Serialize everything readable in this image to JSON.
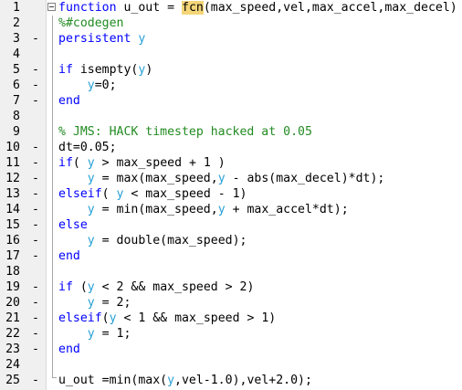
{
  "editor": {
    "line_numbers": [
      "1",
      "2",
      "3",
      "4",
      "5",
      "6",
      "7",
      "8",
      "9",
      "10",
      "11",
      "12",
      "13",
      "14",
      "15",
      "16",
      "17",
      "18",
      "19",
      "20",
      "21",
      "22",
      "23",
      "24",
      "25"
    ],
    "lines": [
      {
        "dash": false,
        "tokens": [
          {
            "t": "function",
            "c": "kw"
          },
          {
            "t": " u_out = "
          },
          {
            "t": "fcn",
            "c": "hl"
          },
          {
            "t": "(max_speed,vel,max_accel,max_decel)"
          }
        ]
      },
      {
        "dash": false,
        "tokens": [
          {
            "t": "%#codegen",
            "c": "cm"
          }
        ]
      },
      {
        "dash": true,
        "tokens": [
          {
            "t": "persistent",
            "c": "kw"
          },
          {
            "t": " "
          },
          {
            "t": "y",
            "c": "pv"
          }
        ]
      },
      {
        "dash": false,
        "tokens": []
      },
      {
        "dash": true,
        "tokens": [
          {
            "t": "if",
            "c": "kw"
          },
          {
            "t": " isempty("
          },
          {
            "t": "y",
            "c": "pv"
          },
          {
            "t": ")"
          }
        ]
      },
      {
        "dash": true,
        "tokens": [
          {
            "t": "    "
          },
          {
            "t": "y",
            "c": "pv"
          },
          {
            "t": "=0;"
          }
        ]
      },
      {
        "dash": true,
        "tokens": [
          {
            "t": "end",
            "c": "kw"
          }
        ]
      },
      {
        "dash": false,
        "tokens": []
      },
      {
        "dash": false,
        "tokens": [
          {
            "t": "% JMS: HACK timestep hacked at 0.05",
            "c": "cm"
          }
        ]
      },
      {
        "dash": true,
        "tokens": [
          {
            "t": "dt=0.05;"
          }
        ]
      },
      {
        "dash": true,
        "tokens": [
          {
            "t": "if",
            "c": "kw"
          },
          {
            "t": "( "
          },
          {
            "t": "y",
            "c": "pv"
          },
          {
            "t": " > max_speed + 1 )"
          }
        ]
      },
      {
        "dash": true,
        "tokens": [
          {
            "t": "    "
          },
          {
            "t": "y",
            "c": "pv"
          },
          {
            "t": " = max(max_speed,"
          },
          {
            "t": "y",
            "c": "pv"
          },
          {
            "t": " - abs(max_decel)*dt);"
          }
        ]
      },
      {
        "dash": true,
        "tokens": [
          {
            "t": "elseif",
            "c": "kw"
          },
          {
            "t": "( "
          },
          {
            "t": "y",
            "c": "pv"
          },
          {
            "t": " < max_speed - 1)"
          }
        ]
      },
      {
        "dash": true,
        "tokens": [
          {
            "t": "    "
          },
          {
            "t": "y",
            "c": "pv"
          },
          {
            "t": " = min(max_speed,"
          },
          {
            "t": "y",
            "c": "pv"
          },
          {
            "t": " + max_accel*dt);"
          }
        ]
      },
      {
        "dash": true,
        "tokens": [
          {
            "t": "else",
            "c": "kw"
          }
        ]
      },
      {
        "dash": true,
        "tokens": [
          {
            "t": "    "
          },
          {
            "t": "y",
            "c": "pv"
          },
          {
            "t": " = double(max_speed);"
          }
        ]
      },
      {
        "dash": true,
        "tokens": [
          {
            "t": "end",
            "c": "kw"
          }
        ]
      },
      {
        "dash": false,
        "tokens": []
      },
      {
        "dash": true,
        "tokens": [
          {
            "t": "if",
            "c": "kw"
          },
          {
            "t": " ("
          },
          {
            "t": "y",
            "c": "pv"
          },
          {
            "t": " < 2 && max_speed > 2)"
          }
        ]
      },
      {
        "dash": true,
        "tokens": [
          {
            "t": "    "
          },
          {
            "t": "y",
            "c": "pv"
          },
          {
            "t": " = 2;"
          }
        ]
      },
      {
        "dash": true,
        "tokens": [
          {
            "t": "elseif",
            "c": "kw"
          },
          {
            "t": "("
          },
          {
            "t": "y",
            "c": "pv"
          },
          {
            "t": " < 1 && max_speed > 1)"
          }
        ]
      },
      {
        "dash": true,
        "tokens": [
          {
            "t": "    "
          },
          {
            "t": "y",
            "c": "pv"
          },
          {
            "t": " = 1;"
          }
        ]
      },
      {
        "dash": true,
        "tokens": [
          {
            "t": "end",
            "c": "kw"
          }
        ]
      },
      {
        "dash": false,
        "tokens": []
      },
      {
        "dash": true,
        "tokens": [
          {
            "t": "u_out =min(max("
          },
          {
            "t": "y",
            "c": "pv"
          },
          {
            "t": ",vel-1.0),vel+2.0);"
          }
        ]
      }
    ],
    "breakpoint_marker": "-",
    "colors": {
      "keyword": "#0000ff",
      "comment": "#228b22",
      "persistent_variable": "#26a0d6",
      "highlight": "#f4d679",
      "gutter": "#f0f0f0"
    }
  }
}
